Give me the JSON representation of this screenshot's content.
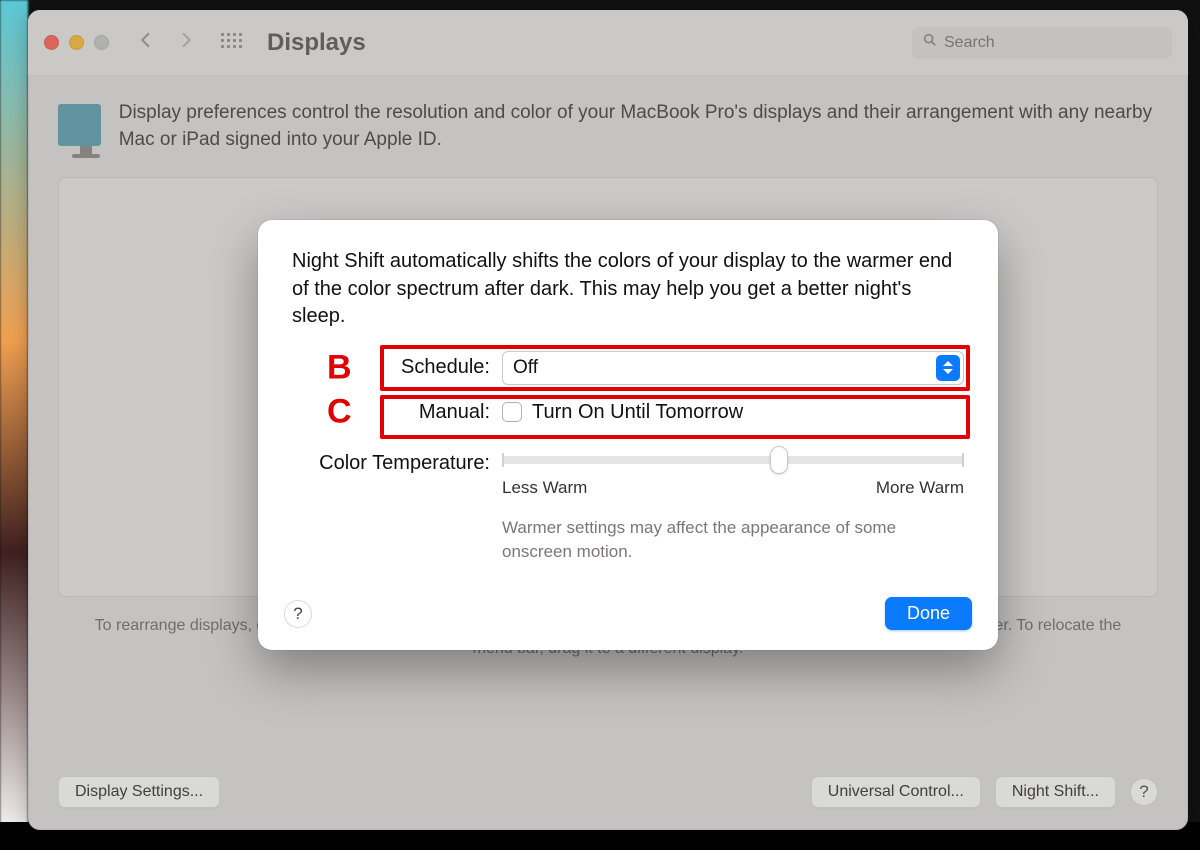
{
  "toolbar": {
    "title": "Displays",
    "search_placeholder": "Search"
  },
  "header": {
    "text": "Display preferences control the resolution and color of your MacBook Pro's displays and their arrangement with any nearby Mac or iPad signed into your Apple ID."
  },
  "footer_help": "To rearrange displays, drag them to the desired position. To mirror displays, hold Option while dragging them on top of each other. To relocate the menu bar, drag it to a different display.",
  "buttons": {
    "display_settings": "Display Settings...",
    "universal_control": "Universal Control...",
    "night_shift": "Night Shift..."
  },
  "sheet": {
    "description": "Night Shift automatically shifts the colors of your display to the warmer end of the color spectrum after dark. This may help you get a better night's sleep.",
    "schedule_label": "Schedule:",
    "schedule_value": "Off",
    "manual_label": "Manual:",
    "manual_checkbox_label": "Turn On Until Tomorrow",
    "color_temp_label": "Color Temperature:",
    "less_warm": "Less Warm",
    "more_warm": "More Warm",
    "slider_note": "Warmer settings may affect the appearance of some onscreen motion.",
    "done": "Done"
  },
  "annotations": {
    "b": "B",
    "c": "C"
  },
  "colors": {
    "accent": "#0a7aff",
    "annotation": "#e20000"
  }
}
